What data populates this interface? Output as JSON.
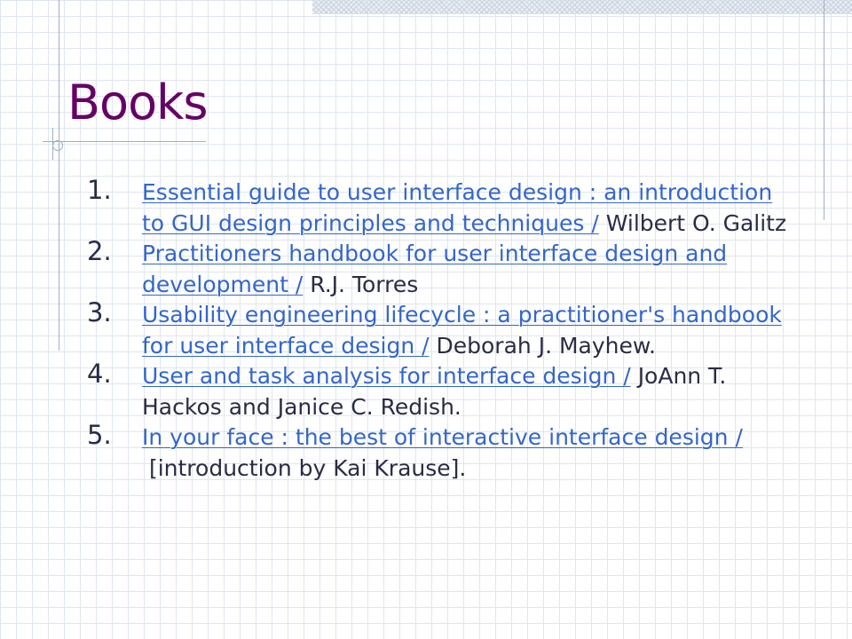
{
  "slide": {
    "title": "Books",
    "books": [
      {
        "number": "1.",
        "link_text": "Essential guide to user interface design : an introduction to GUI design principles and techniques /",
        "author_text": "Wilbert O. Galitz"
      },
      {
        "number": "2.",
        "link_text": "Practitioners handbook for user interface design and development /",
        "author_text": "R.J. Torres"
      },
      {
        "number": "3.",
        "link_text": "Usability engineering lifecycle : a practitioner's handbook for user interface design /",
        "author_text": "Deborah J. Mayhew."
      },
      {
        "number": "4.",
        "link_text": "User and task analysis for interface design /",
        "author_text": "JoAnn T. Hackos and Janice C. Redish."
      },
      {
        "number": "5.",
        "link_text": "In your face : the best of interactive interface design /",
        "author_text": "[introduction by Kai Krause]."
      }
    ]
  }
}
